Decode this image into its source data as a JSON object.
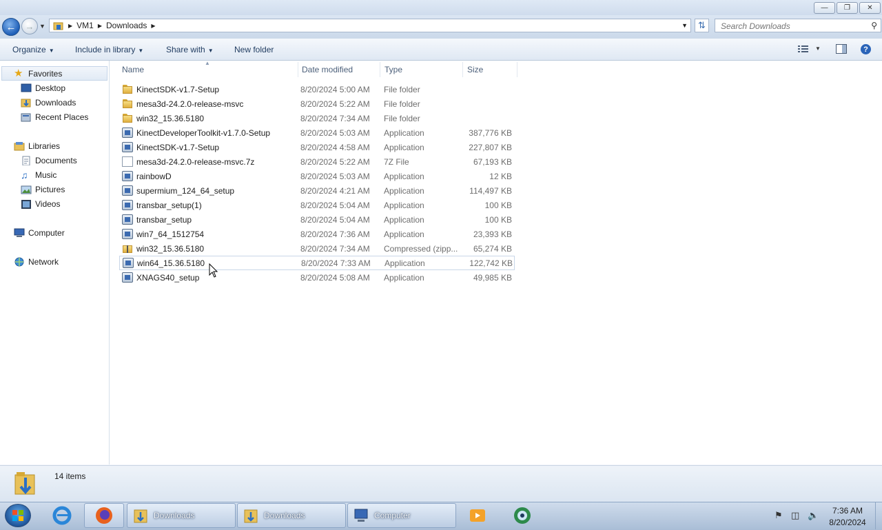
{
  "window": {
    "minimize": "—",
    "restore": "❐",
    "close": "✕"
  },
  "address": {
    "crumbs": [
      "VM1",
      "Downloads"
    ],
    "search_placeholder": "Search Downloads"
  },
  "toolbar": {
    "organize": "Organize",
    "include_in_library": "Include in library",
    "share_with": "Share with",
    "new_folder": "New folder"
  },
  "nav": {
    "favorites": "Favorites",
    "desktop": "Desktop",
    "downloads": "Downloads",
    "recent_places": "Recent Places",
    "libraries": "Libraries",
    "documents": "Documents",
    "music": "Music",
    "pictures": "Pictures",
    "videos": "Videos",
    "computer": "Computer",
    "network": "Network"
  },
  "columns": {
    "name": "Name",
    "date": "Date modified",
    "type": "Type",
    "size": "Size"
  },
  "files": [
    {
      "name": "KinectSDK-v1.7-Setup",
      "date": "8/20/2024 5:00 AM",
      "type": "File folder",
      "size": "",
      "icon": "folder-icon"
    },
    {
      "name": "mesa3d-24.2.0-release-msvc",
      "date": "8/20/2024 5:22 AM",
      "type": "File folder",
      "size": "",
      "icon": "folder-icon"
    },
    {
      "name": "win32_15.36.5180",
      "date": "8/20/2024 7:34 AM",
      "type": "File folder",
      "size": "",
      "icon": "folder-icon"
    },
    {
      "name": "KinectDeveloperToolkit-v1.7.0-Setup",
      "date": "8/20/2024 5:03 AM",
      "type": "Application",
      "size": "387,776 KB",
      "icon": "application-icon"
    },
    {
      "name": "KinectSDK-v1.7-Setup",
      "date": "8/20/2024 4:58 AM",
      "type": "Application",
      "size": "227,807 KB",
      "icon": "application-icon"
    },
    {
      "name": "mesa3d-24.2.0-release-msvc.7z",
      "date": "8/20/2024 5:22 AM",
      "type": "7Z File",
      "size": "67,193 KB",
      "icon": "document-icon"
    },
    {
      "name": "rainbowD",
      "date": "8/20/2024 5:03 AM",
      "type": "Application",
      "size": "12 KB",
      "icon": "application-icon"
    },
    {
      "name": "supermium_124_64_setup",
      "date": "8/20/2024 4:21 AM",
      "type": "Application",
      "size": "114,497 KB",
      "icon": "application-icon"
    },
    {
      "name": "transbar_setup(1)",
      "date": "8/20/2024 5:04 AM",
      "type": "Application",
      "size": "100 KB",
      "icon": "application-icon"
    },
    {
      "name": "transbar_setup",
      "date": "8/20/2024 5:04 AM",
      "type": "Application",
      "size": "100 KB",
      "icon": "application-icon"
    },
    {
      "name": "win7_64_1512754",
      "date": "8/20/2024 7:36 AM",
      "type": "Application",
      "size": "23,393 KB",
      "icon": "application-icon"
    },
    {
      "name": "win32_15.36.5180",
      "date": "8/20/2024 7:34 AM",
      "type": "Compressed (zipp...",
      "size": "65,274 KB",
      "icon": "zip-folder-icon"
    },
    {
      "name": "win64_15.36.5180",
      "date": "8/20/2024 7:33 AM",
      "type": "Application",
      "size": "122,742 KB",
      "icon": "application-icon"
    },
    {
      "name": "XNAGS40_setup",
      "date": "8/20/2024 5:08 AM",
      "type": "Application",
      "size": "49,985 KB",
      "icon": "application-icon"
    }
  ],
  "status": {
    "count": "14 items"
  },
  "taskbar": {
    "btn1": "Downloads",
    "btn2": "Downloads",
    "btn3": "Computer",
    "time": "7:36 AM",
    "date": "8/20/2024"
  }
}
